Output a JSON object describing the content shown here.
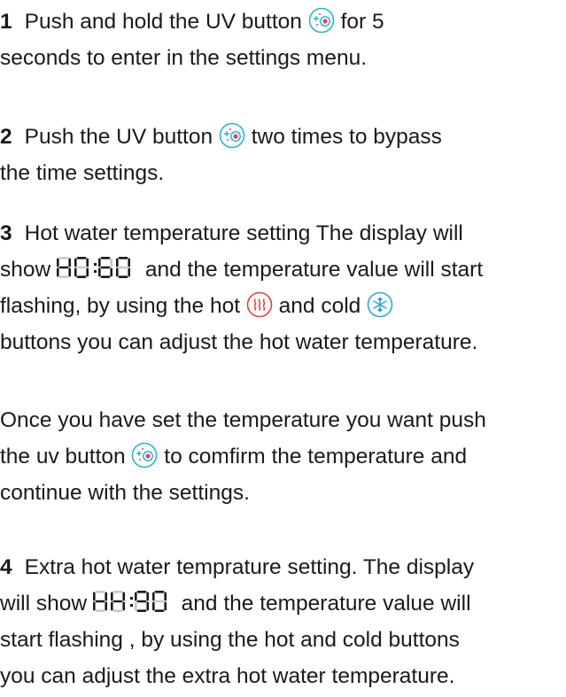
{
  "steps": [
    {
      "number": "1",
      "l1a": "Push and hold the UV button",
      "l1b": "for 5",
      "l2": "seconds to enter in the settings menu."
    },
    {
      "number": "2",
      "l1a": "Push the UV button",
      "l1b": "two times to bypass",
      "l2": "the time settings."
    },
    {
      "number": "3",
      "l1": "Hot water temperature setting The display will",
      "l2a": "show",
      "display": "H0:60",
      "l2b": "and the temperature value will start",
      "l3a": "flashing, by using the hot",
      "l3b": "and cold",
      "l4": "buttons you can adjust the hot water temperature."
    },
    {
      "l1": "Once you have set the temperature you want push",
      "l2a": "the uv button",
      "l2b": "to comfirm the temperature and",
      "l3": "continue with the settings."
    },
    {
      "number": "4",
      "l1": "Extra hot water temprature setting. The display",
      "l2a": "will show",
      "display": "HH:90",
      "l2b": "and the temperature value will",
      "l3": "start flashing , by using the hot and cold buttons",
      "l4": "you can adjust the extra hot water temperature."
    }
  ],
  "icons": {
    "uv": "uv-sparkle-icon",
    "hot": "heat-waves-icon",
    "cold": "snowflake-icon"
  },
  "colors": {
    "icon_outline": "#2fb3c6",
    "uv_dots": "#e53d80",
    "hot": "#e8403a",
    "cold": "#2aa8d8",
    "segment_on": "#1a1a1a",
    "segment_off": "#c8c8c8"
  }
}
